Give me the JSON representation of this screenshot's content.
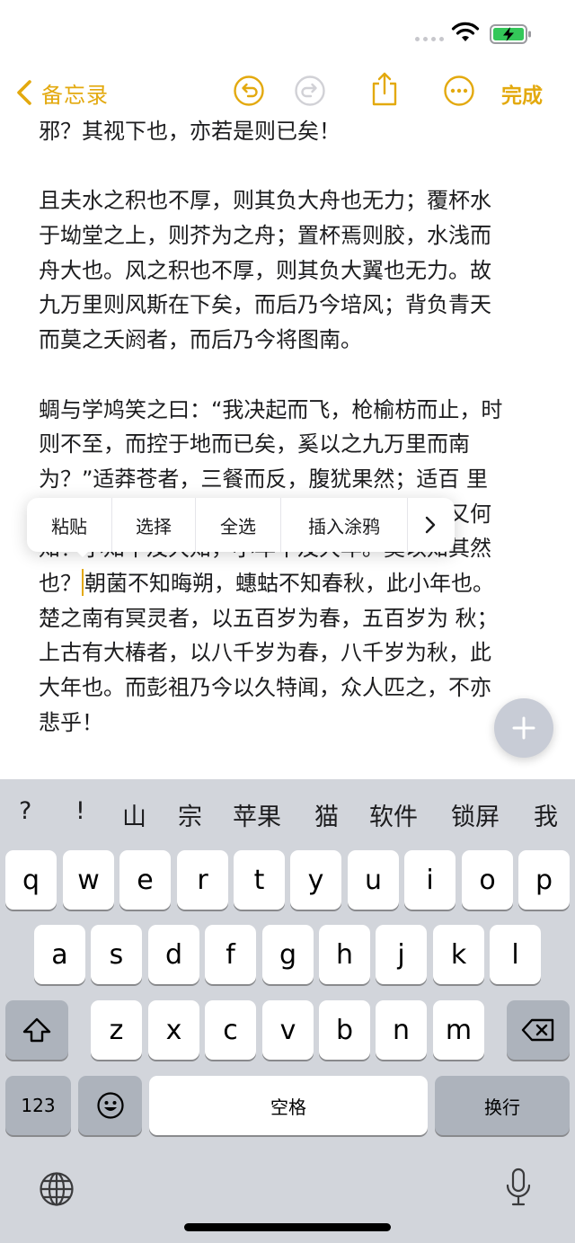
{
  "nav": {
    "back_label": "备忘录",
    "done_label": "完成",
    "accent_color": "#e3a90e"
  },
  "note": {
    "lines": [
      "邪？其视下也，亦若是则已矣！",
      "",
      "且夫水之积也不厚，则其负大舟也无力；覆杯水",
      "于坳堂之上，则芥为之舟；置杯焉则胶，水浅而",
      "舟大也。风之积也不厚，则其负大翼也无力。故",
      "九万里则风斯在下矣，而后乃今培风；背负青天",
      "而莫之夭阏者，而后乃今将图南。",
      "",
      "蜩与学鸠笑之曰：“我决起而飞，枪榆枋而止，时",
      "则不至，而控于地而已矣，奚以之九万里而南",
      "为？”适莽苍者，三餐而反，腹犹果然；适百 里",
      "者，宿舂粮；适千里者，三月聚粮。之二虫又何",
      "知！小知不及大知，小年不及大年。奚以知其然",
      "也？",
      "楚之南有冥灵者，以五百岁为春，五百岁为 秋；",
      "上古有大椿者，以八千岁为春，八千岁为秋，此",
      "大年也。而彭祖乃今以久特闻，众人匹之，不亦",
      "悲乎！"
    ],
    "cursor_line_rest": "朝菌不知晦朔，蟪蛄不知春秋，此小年也。"
  },
  "edit_menu": {
    "paste": "粘贴",
    "select": "选择",
    "select_all": "全选",
    "insert_drawing": "插入涂鸦"
  },
  "keyboard": {
    "suggestions": [
      "?",
      "!",
      "山",
      "宗",
      "苹果",
      "猫",
      "软件",
      "锁屏",
      "我"
    ],
    "row1": [
      "q",
      "w",
      "e",
      "r",
      "t",
      "y",
      "u",
      "i",
      "o",
      "p"
    ],
    "row2": [
      "a",
      "s",
      "d",
      "f",
      "g",
      "h",
      "j",
      "k",
      "l"
    ],
    "row3": [
      "z",
      "x",
      "c",
      "v",
      "b",
      "n",
      "m"
    ],
    "numbers_label": "123",
    "space_label": "空格",
    "return_label": "换行"
  }
}
